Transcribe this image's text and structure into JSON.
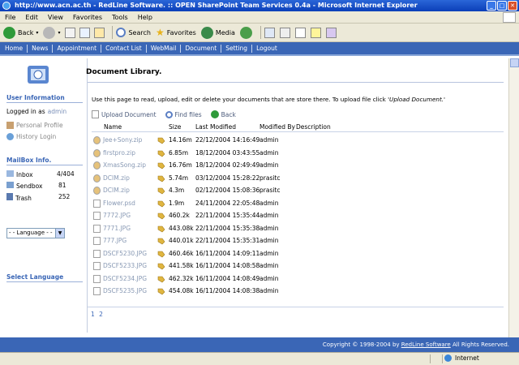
{
  "window": {
    "title": "http://www.acn.ac.th - RedLine Software. :: OPEN SharePoint Team Services 0.4a - Microsoft Internet Explorer"
  },
  "menu": [
    "File",
    "Edit",
    "View",
    "Favorites",
    "Tools",
    "Help"
  ],
  "toolbar": {
    "back_label": "Back",
    "search_label": "Search",
    "favorites_label": "Favorites",
    "media_label": "Media"
  },
  "nav": [
    "Home",
    "News",
    "Appointment",
    "Contact List",
    "WebMail",
    "Document",
    "Setting",
    "Logout"
  ],
  "sidebar": {
    "user_info_title": "User Information",
    "logged_in_label": "Logged in as",
    "username": "admin",
    "personal_profile": "Personal Profile",
    "history_login": "History Login",
    "mailbox_title": "MailBox Info.",
    "mailbox": [
      {
        "label": "Inbox",
        "count": "4/404"
      },
      {
        "label": "Sendbox",
        "count": "81"
      },
      {
        "label": "Trash",
        "count": "252"
      }
    ],
    "language_title": "Select Language",
    "language_value": "- - Language - -"
  },
  "page": {
    "title": "Document Library.",
    "intro": "Use this page to read, upload, edit or delete your documents that are store there. To upload file click ",
    "intro_link": "'Upload Document.'",
    "upload_label": "Upload Document",
    "find_label": "Find files",
    "back_label": "Back"
  },
  "table": {
    "headers": {
      "name": "Name",
      "size": "Size",
      "modified": "Last Modified",
      "modified_by": "Modified By",
      "description": "Description"
    },
    "rows": [
      {
        "name": "Jee+Sony.zip",
        "size": "14.16m",
        "modified": "22/12/2004 14:16:49",
        "by": "admin",
        "type": "zip"
      },
      {
        "name": "firstpro.zip",
        "size": "6.85m",
        "modified": "18/12/2004 03:43:55",
        "by": "admin",
        "type": "zip"
      },
      {
        "name": "XmasSong.zip",
        "size": "16.76m",
        "modified": "18/12/2004 02:49:49",
        "by": "admin",
        "type": "zip"
      },
      {
        "name": "DCIM.zip",
        "size": "5.74m",
        "modified": "03/12/2004 15:28:22",
        "by": "prasitc",
        "type": "zip"
      },
      {
        "name": "DCIM.zip",
        "size": "4.3m",
        "modified": "02/12/2004 15:08:36",
        "by": "prasitc",
        "type": "zip"
      },
      {
        "name": "Flower.psd",
        "size": "1.9m",
        "modified": "24/11/2004 22:05:48",
        "by": "admin",
        "type": "file"
      },
      {
        "name": "7772.JPG",
        "size": "460.2k",
        "modified": "22/11/2004 15:35:44",
        "by": "admin",
        "type": "file"
      },
      {
        "name": "7771.JPG",
        "size": "443.08k",
        "modified": "22/11/2004 15:35:38",
        "by": "admin",
        "type": "file"
      },
      {
        "name": "777.JPG",
        "size": "440.01k",
        "modified": "22/11/2004 15:35:31",
        "by": "admin",
        "type": "file"
      },
      {
        "name": "DSCF5230.JPG",
        "size": "460.46k",
        "modified": "16/11/2004 14:09:11",
        "by": "admin",
        "type": "file"
      },
      {
        "name": "DSCF5233.JPG",
        "size": "441.58k",
        "modified": "16/11/2004 14:08:58",
        "by": "admin",
        "type": "file"
      },
      {
        "name": "DSCF5234.JPG",
        "size": "462.32k",
        "modified": "16/11/2004 14:08:49",
        "by": "admin",
        "type": "file"
      },
      {
        "name": "DSCF5235.JPG",
        "size": "454.08k",
        "modified": "16/11/2004 14:08:38",
        "by": "admin",
        "type": "file"
      }
    ]
  },
  "pager": {
    "current": "1",
    "next": "2"
  },
  "footer": {
    "prefix": "Copyright © 1998-2004 by ",
    "company": "RedLine Software",
    "suffix": " All Rights Reserved."
  },
  "status": {
    "zone": "Internet"
  },
  "colors": {
    "nav_bar": "#3a66b6",
    "sidebar_heading": "#3a66b6",
    "titlebar": "#0b3fb8"
  }
}
